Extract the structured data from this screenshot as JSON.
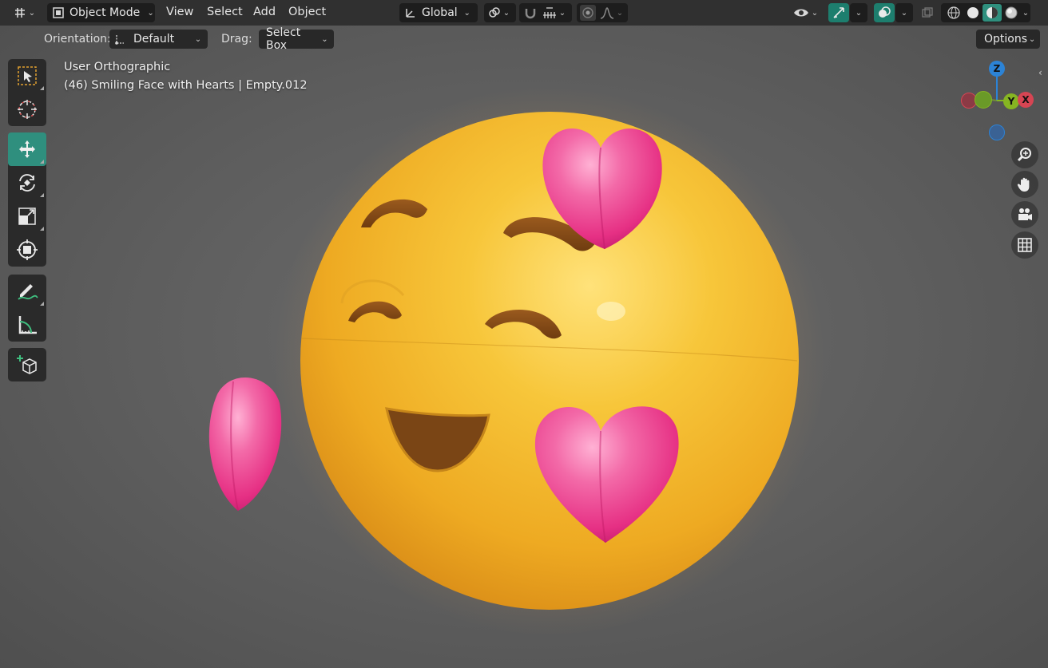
{
  "header": {
    "editor_type_icon": "axis-grid-icon",
    "mode_icon": "object-mode-icon",
    "mode_label": "Object Mode",
    "menus": [
      "View",
      "Select",
      "Add",
      "Object"
    ],
    "transform_orientation": "Global",
    "transform_orientation_icon": "transform-axes-icon",
    "pivot_icon": "pivot-link-icon",
    "snap_icon": "magnet-icon",
    "snap_target_icon": "snap-increment-icon",
    "proportional_icon": "proportional-edit-icon",
    "falloff_icon": "falloff-curve-icon",
    "visibility_icon": "eye-icon",
    "gizmo_icon": "gizmo-arrows-icon",
    "overlay_icon": "overlay-circles-icon",
    "xray_icon": "xray-icon",
    "shading_modes": [
      "wireframe-shading-icon",
      "solid-shading-icon",
      "material-preview-icon",
      "rendered-shading-icon"
    ]
  },
  "tool_settings": {
    "orientation_label": "Orientation:",
    "orientation_value": "Default",
    "drag_label": "Drag:",
    "drag_value": "Select Box",
    "options_label": "Options"
  },
  "toolbar": {
    "tools": [
      {
        "name": "select-box-icon",
        "active": false
      },
      {
        "name": "cursor-icon",
        "active": false
      },
      {
        "name": "move-icon",
        "active": true
      },
      {
        "name": "rotate-icon",
        "active": false
      },
      {
        "name": "scale-icon",
        "active": false
      },
      {
        "name": "transform-icon",
        "active": false
      },
      {
        "name": "annotate-icon",
        "active": false
      },
      {
        "name": "measure-icon",
        "active": false
      },
      {
        "name": "add-cube-icon",
        "active": false
      }
    ]
  },
  "viewport": {
    "view_name": "User Orthographic",
    "object_info": "(46) Smiling Face with Hearts | Empty.012"
  },
  "navigation": {
    "gizmo_axes": {
      "z": "Z",
      "y": "Y",
      "x": "X"
    },
    "buttons": [
      "zoom-icon",
      "hand-pan-icon",
      "camera-icon",
      "grid-icon"
    ]
  },
  "colors": {
    "accent": "#2f8f7e",
    "emoji_face": "#f2b51f",
    "heart": "#e8418c",
    "axis_x": "#d64553",
    "axis_y": "#86b522",
    "axis_z": "#2c83d6"
  }
}
